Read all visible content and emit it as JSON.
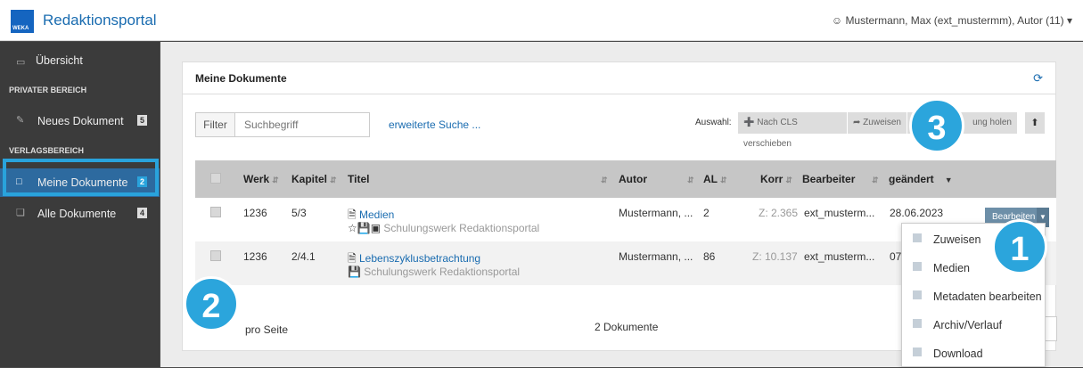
{
  "app": {
    "logo_text": "WEKA",
    "title": "Redaktionsportal"
  },
  "user": {
    "label": "Mustermann, Max (ext_mustermm), Autor (11)"
  },
  "sidebar": {
    "overview": "Übersicht",
    "section_private": "PRIVATER BEREICH",
    "new_doc": {
      "label": "Neues Dokument",
      "badge": "5"
    },
    "section_publisher": "VERLAGSBEREICH",
    "my_docs": {
      "label": "Meine Dokumente",
      "badge": "2"
    },
    "all_docs": {
      "label": "Alle Dokumente",
      "badge": "4"
    }
  },
  "card": {
    "title": "Meine Dokumente"
  },
  "toolbar": {
    "filter_label": "Filter",
    "search_placeholder": "Suchbegriff",
    "extended_search": "erweiterte Suche ...",
    "selection_label": "Auswahl:",
    "move_cls": "Nach CLS verschieben",
    "assign": "Zuweisen",
    "fetch": "ung holen"
  },
  "table": {
    "headers": {
      "werk": "Werk",
      "kapitel": "Kapitel",
      "titel": "Titel",
      "autor": "Autor",
      "al": "AL",
      "korr": "Korr",
      "bearbeiter": "Bearbeiter",
      "geaendert": "geändert"
    },
    "rows": [
      {
        "werk": "1236",
        "kapitel": "5/3",
        "titel": "Medien",
        "sub": "Schulungswerk Redaktionsportal",
        "autor": "Mustermann, ...",
        "al": "2",
        "korr": "Z: 2.365",
        "bearbeiter": "ext_musterm...",
        "geaendert": "28.06.2023"
      },
      {
        "werk": "1236",
        "kapitel": "2/4.1",
        "titel": "Lebenszyklusbetrachtung",
        "sub": "Schulungswerk Redaktionsportal",
        "autor": "Mustermann, ...",
        "al": "86",
        "korr": "Z: 10.137",
        "bearbeiter": "ext_musterm...",
        "geaendert": "07"
      }
    ]
  },
  "row_action": {
    "edit": "Bearbeiten"
  },
  "footer": {
    "per_page": "pro Seite",
    "doc_count": "2 Dokumente"
  },
  "dropdown": [
    "Zuweisen",
    "Medien",
    "Metadaten bearbeiten",
    "Archiv/Verlauf",
    "Download"
  ],
  "callouts": [
    "1",
    "2",
    "3"
  ],
  "colors": {
    "accent": "#2ba5dc",
    "link": "#1a6cb0",
    "sidebar": "#3b3b3b"
  }
}
